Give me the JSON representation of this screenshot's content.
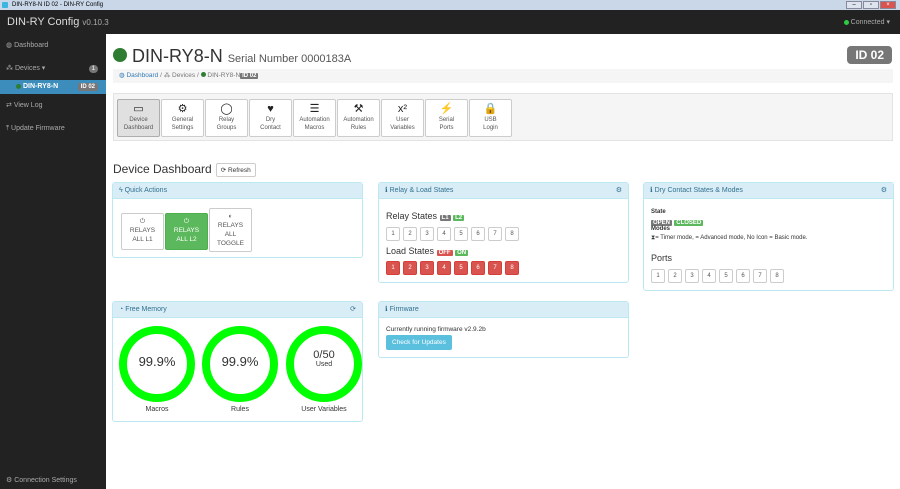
{
  "window": {
    "title": "DIN-RY8-N ID 02 - DIN-RY Config"
  },
  "navbar": {
    "brand": "DIN-RY Config",
    "version": "v0.10.3",
    "status": "Connected ▾"
  },
  "sidebar": {
    "dashboard": "Dashboard",
    "devices": "Devices ▾",
    "devices_count": "1",
    "device_name": "DIN-RY8-N",
    "device_id": "ID 02",
    "view_log": "View Log",
    "update_firmware": "Update Firmware",
    "connection_settings": "Connection Settings"
  },
  "header": {
    "device": "DIN-RY8-N",
    "serial": "Serial Number 0000183A",
    "id_badge": "ID 02"
  },
  "breadcrumb": {
    "dashboard": "Dashboard",
    "devices": "Devices",
    "device": "DIN-RY8-N",
    "id": "ID 02"
  },
  "toolbar": [
    {
      "l1": "Device",
      "l2": "Dashboard",
      "icon": "hdd"
    },
    {
      "l1": "General",
      "l2": "Settings",
      "icon": "⚙"
    },
    {
      "l1": "Relay",
      "l2": "Groups",
      "icon": "◯"
    },
    {
      "l1": "Dry",
      "l2": "Contact",
      "icon": "♥"
    },
    {
      "l1": "Automation",
      "l2": "Macros",
      "icon": "☰"
    },
    {
      "l1": "Automation",
      "l2": "Rules",
      "icon": "⚒"
    },
    {
      "l1": "User",
      "l2": "Variables",
      "icon": "x²"
    },
    {
      "l1": "Serial",
      "l2": "Ports",
      "icon": "⚡"
    },
    {
      "l1": "USB",
      "l2": "Login",
      "icon": "🔒"
    }
  ],
  "section": {
    "title": "Device Dashboard",
    "refresh": "Refresh"
  },
  "quick_actions": {
    "title": "Quick Actions",
    "b1": [
      "RELAYS",
      "ALL L1"
    ],
    "b2": [
      "RELAYS",
      "ALL L2"
    ],
    "b3": [
      "RELAYS",
      "ALL",
      "TOGGLE"
    ]
  },
  "relay_load": {
    "title": "Relay & Load States",
    "relay_label": "Relay States",
    "l1": "L1",
    "l2": "L2",
    "load_label": "Load States",
    "off": "OFF",
    "on": "ON",
    "relays": [
      "1",
      "2",
      "3",
      "4",
      "5",
      "6",
      "7",
      "8"
    ],
    "loads": [
      "1",
      "2",
      "3",
      "4",
      "5",
      "6",
      "7",
      "8"
    ]
  },
  "dry_contact": {
    "title": "Dry Contact States & Modes",
    "state": "State",
    "open": "OPEN",
    "closed": "CLOSED",
    "modes": "Modes",
    "modes_text": "= Timer mode,  = Advanced mode, No Icon = Basic mode.",
    "ports_label": "Ports",
    "ports": [
      "1",
      "2",
      "3",
      "4",
      "5",
      "6",
      "7",
      "8"
    ]
  },
  "memory": {
    "title": "Free Memory",
    "macros": {
      "value": "99.9%",
      "label": "Macros",
      "fraction": 0.999
    },
    "rules": {
      "value": "99.9%",
      "label": "Rules",
      "fraction": 0.999
    },
    "vars": {
      "value": "0/50",
      "sub": "Used",
      "label": "User Variables"
    }
  },
  "firmware": {
    "title": "Firmware",
    "text": "Currently running firmware v2.9.2b",
    "button": "Check for Updates"
  },
  "colors": {
    "ring": "#00ff00",
    "accent": "#3c8dbc",
    "danger": "#d9534f",
    "success": "#5cb85c"
  }
}
